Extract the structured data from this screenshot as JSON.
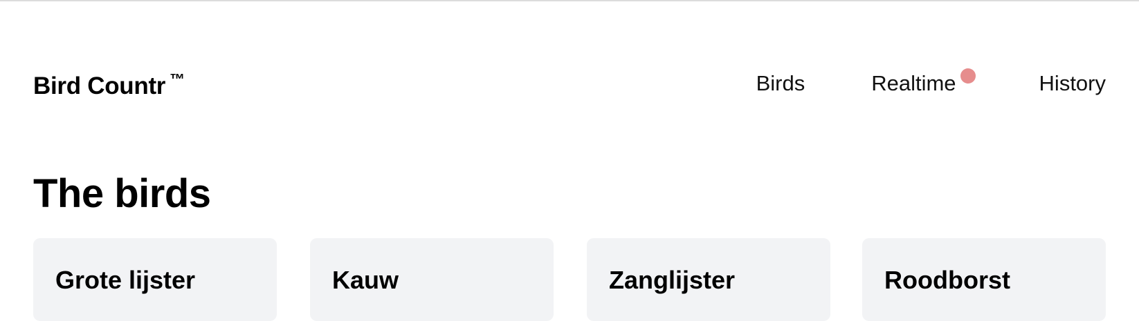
{
  "app": {
    "brand": "Bird Countr",
    "brand_mark": "™"
  },
  "nav": {
    "items": [
      {
        "label": "Birds"
      },
      {
        "label": "Realtime",
        "has_notification": true
      },
      {
        "label": "History"
      }
    ],
    "notification_color": "#e68d8d"
  },
  "main": {
    "title": "The birds",
    "birds": [
      {
        "name": "Grote lijster"
      },
      {
        "name": "Kauw"
      },
      {
        "name": "Zanglijster"
      },
      {
        "name": "Roodborst"
      }
    ],
    "card_background": "#f2f3f5"
  }
}
